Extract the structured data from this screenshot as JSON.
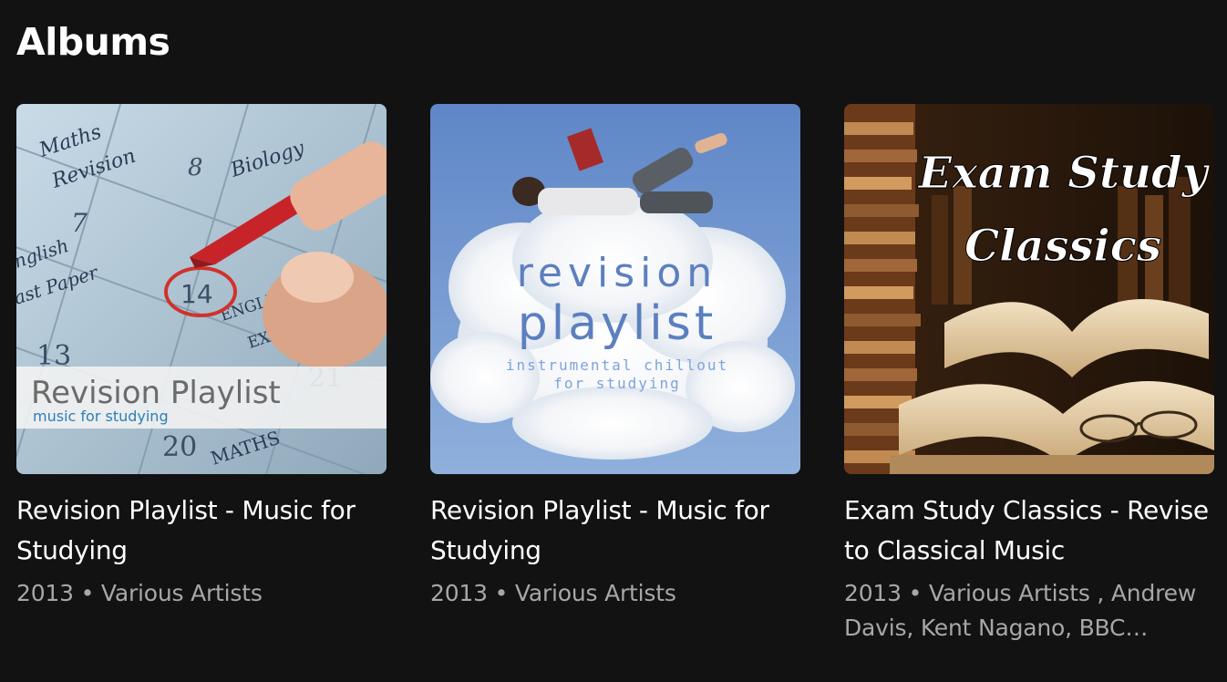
{
  "section": {
    "title": "Albums"
  },
  "albums": [
    {
      "title": "Revision Playlist - Music for Studying",
      "meta": "2013 • Various Artists",
      "cover": {
        "line1": "Revision Playlist",
        "line2": "music for studying",
        "notes": [
          "Maths",
          "Revision",
          "8",
          "Biology",
          "7",
          "nglish",
          "ast Paper",
          "14",
          "ENGLISH",
          "EXAM",
          "13",
          "21",
          "20",
          "MATHS"
        ]
      }
    },
    {
      "title": "Revision Playlist - Music for Studying",
      "meta": "2013 • Various Artists",
      "cover": {
        "line1": "revision",
        "line2": "playlist",
        "line3": "instrumental chillout",
        "line4": "for studying"
      }
    },
    {
      "title": "Exam Study Classics - Revise to Classical Music",
      "meta": "2013 • Various Artists , Andrew Davis, Kent Nagano, BBC…",
      "cover": {
        "line1": "Exam Study",
        "line2": "Classics"
      }
    }
  ]
}
